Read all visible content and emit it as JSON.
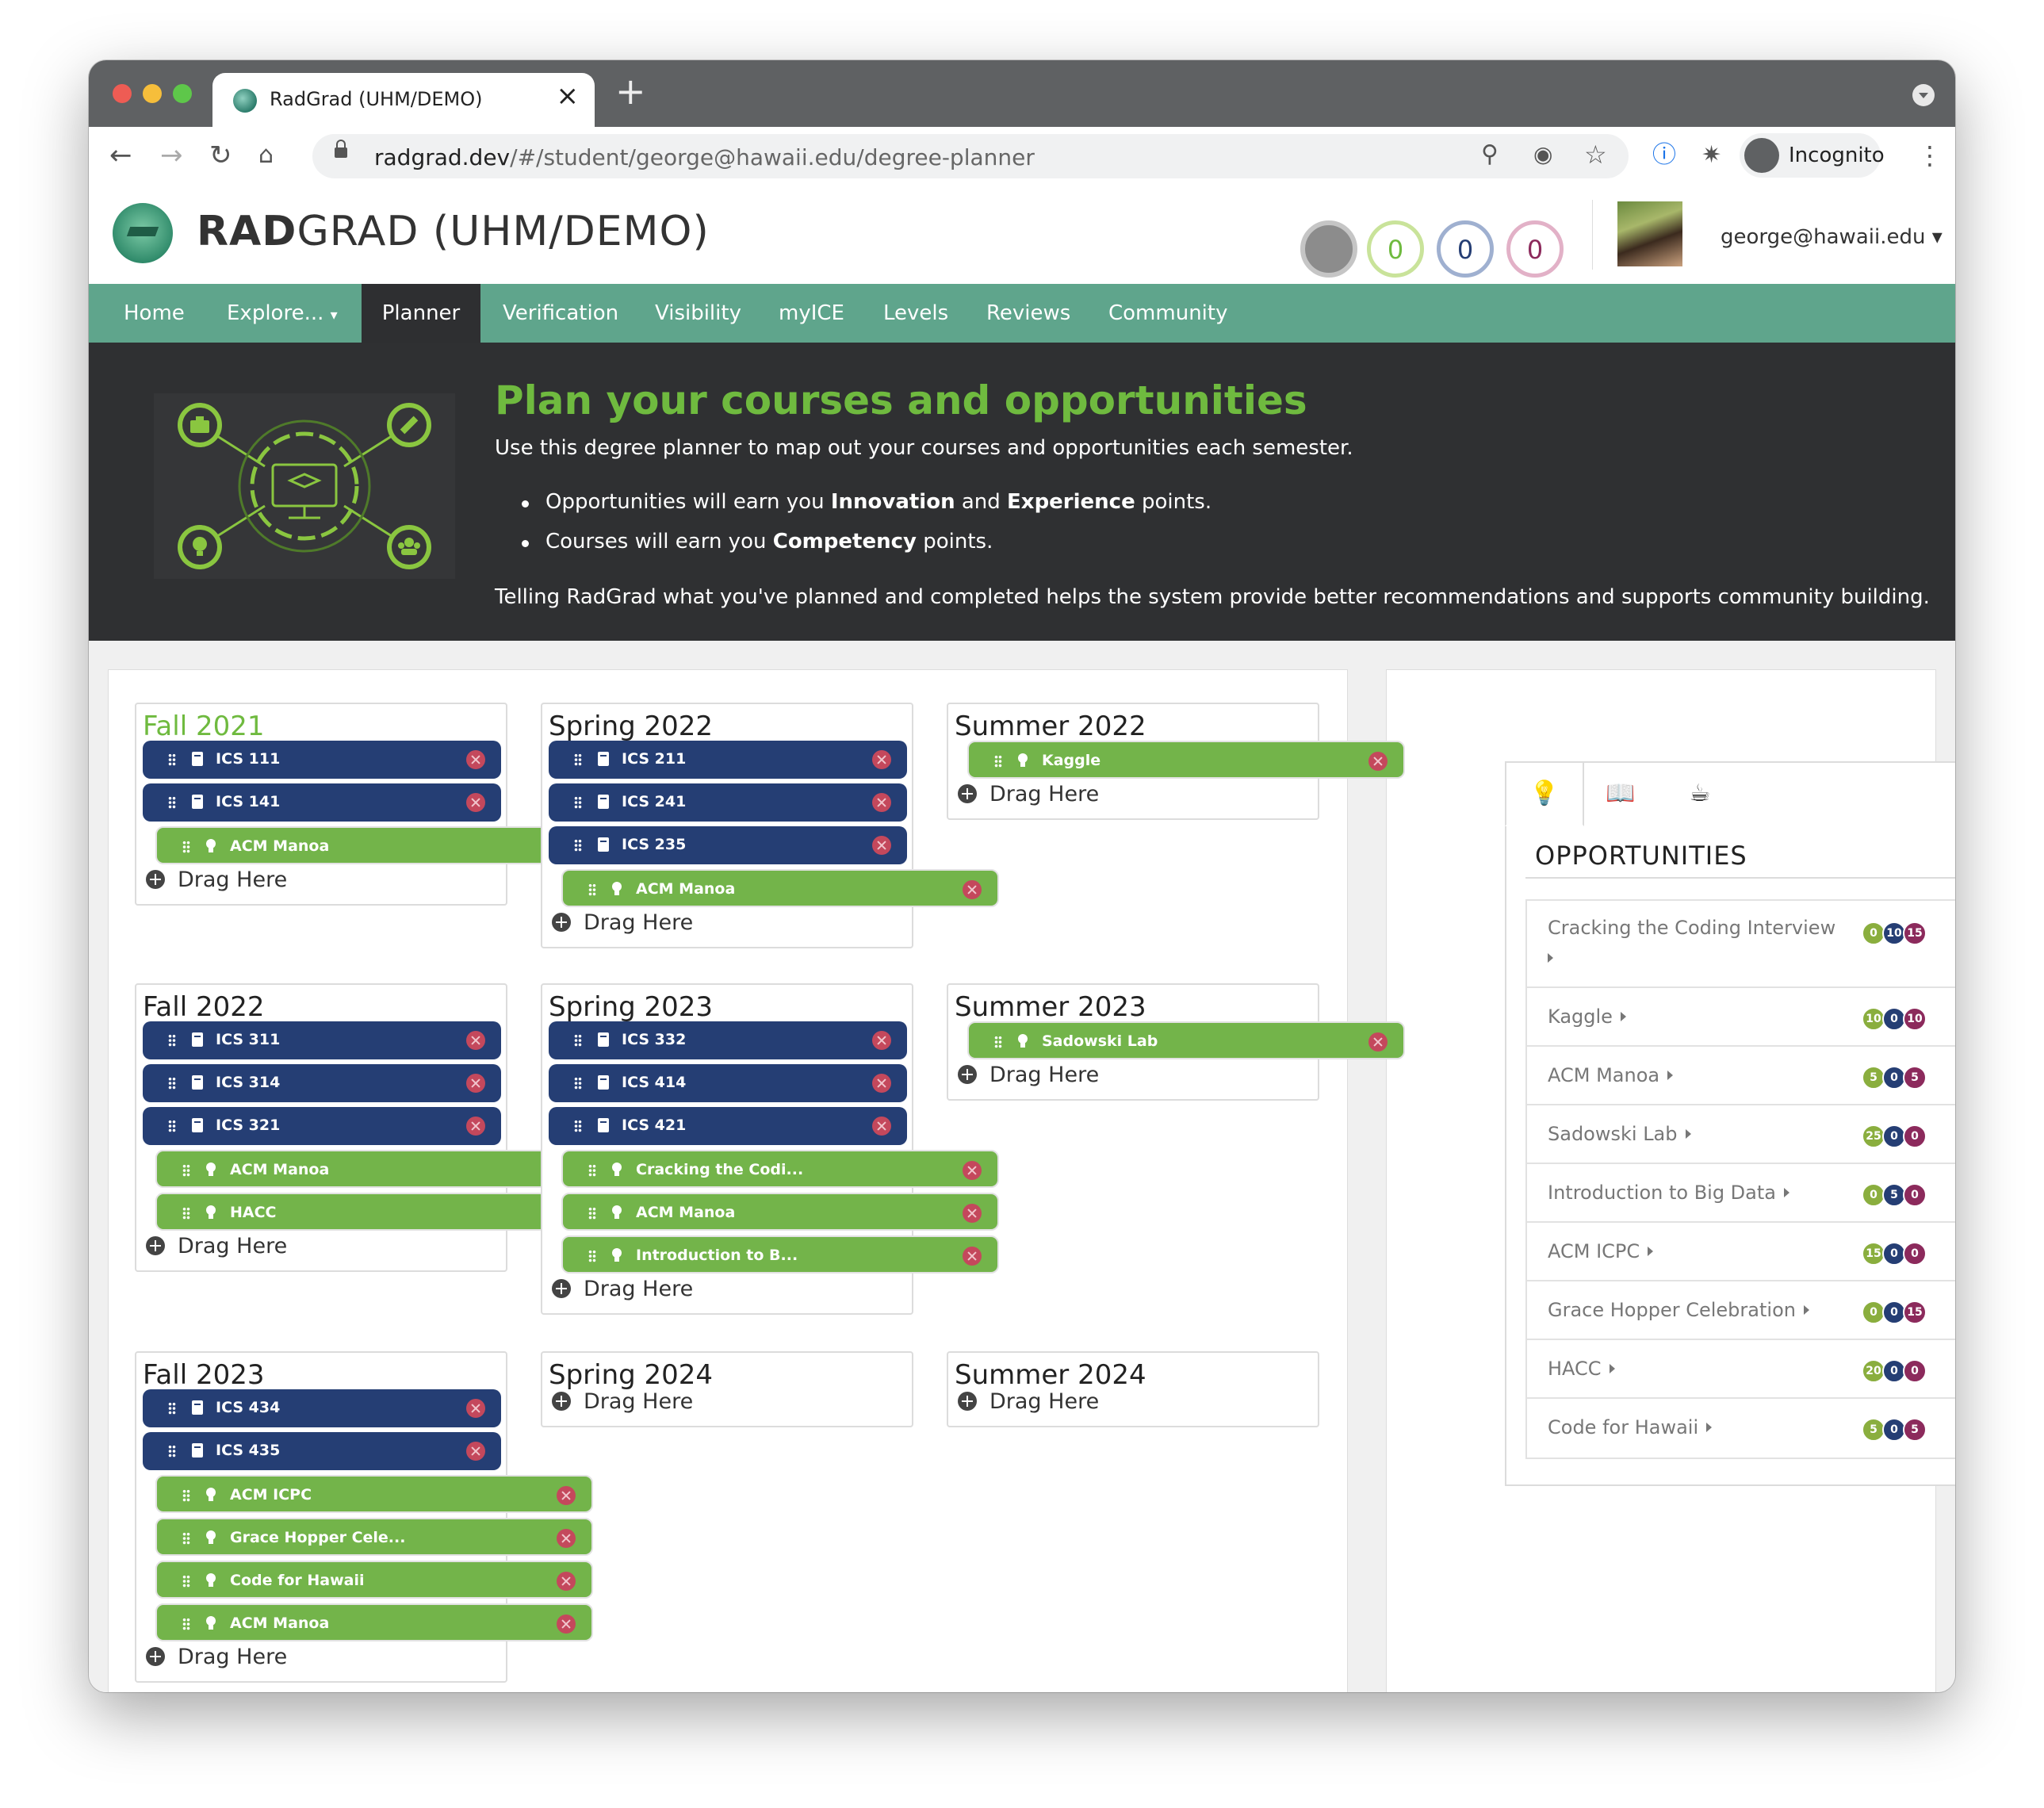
{
  "browser": {
    "tab_title": "RadGrad (UHM/DEMO)",
    "url_host": "radgrad.dev",
    "url_path": "/#/student/george@hawaii.edu/degree-planner",
    "incognito_label": "Incognito"
  },
  "header": {
    "brand_bold": "RAD",
    "brand_rest": "GRAD (UHM/DEMO)",
    "ice_innovation": "0",
    "ice_competency": "0",
    "ice_experience": "0",
    "user_label": "george@hawaii.edu"
  },
  "nav": {
    "items": [
      "Home",
      "Explore...",
      "Planner",
      "Verification",
      "Visibility",
      "myICE",
      "Levels",
      "Reviews",
      "Community"
    ],
    "active": "Planner"
  },
  "banner": {
    "title": "Plan your courses and opportunities",
    "intro": "Use this degree planner to map out your courses and opportunities each semester.",
    "bullet1_a": "Opportunities will earn you ",
    "bullet1_b": "Innovation",
    "bullet1_c": " and ",
    "bullet1_d": "Experience",
    "bullet1_e": " points.",
    "bullet2_a": "Courses will earn you ",
    "bullet2_b": "Competency",
    "bullet2_c": " points.",
    "footer": "Telling RadGrad what you've planned and completed helps the system provide better recommendations and supports community building."
  },
  "planner": {
    "drag_label": "Drag Here",
    "semesters": [
      {
        "name": "Fall 2021",
        "current": true,
        "items": [
          {
            "type": "course",
            "label": "ICS 111"
          },
          {
            "type": "course",
            "label": "ICS 141"
          },
          {
            "type": "opp",
            "label": "ACM Manoa"
          }
        ]
      },
      {
        "name": "Spring 2022",
        "items": [
          {
            "type": "course",
            "label": "ICS 211"
          },
          {
            "type": "course",
            "label": "ICS 241"
          },
          {
            "type": "course",
            "label": "ICS 235"
          },
          {
            "type": "opp",
            "label": "ACM Manoa"
          }
        ]
      },
      {
        "name": "Summer 2022",
        "items": [
          {
            "type": "opp",
            "label": "Kaggle"
          }
        ]
      },
      {
        "name": "Fall 2022",
        "items": [
          {
            "type": "course",
            "label": "ICS 311"
          },
          {
            "type": "course",
            "label": "ICS 314"
          },
          {
            "type": "course",
            "label": "ICS 321"
          },
          {
            "type": "opp",
            "label": "ACM Manoa"
          },
          {
            "type": "opp",
            "label": "HACC"
          }
        ]
      },
      {
        "name": "Spring 2023",
        "items": [
          {
            "type": "course",
            "label": "ICS 332"
          },
          {
            "type": "course",
            "label": "ICS 414"
          },
          {
            "type": "course",
            "label": "ICS 421"
          },
          {
            "type": "opp",
            "label": "Cracking the Codi..."
          },
          {
            "type": "opp",
            "label": "ACM Manoa"
          },
          {
            "type": "opp",
            "label": "Introduction to B..."
          }
        ]
      },
      {
        "name": "Summer 2023",
        "items": [
          {
            "type": "opp",
            "label": "Sadowski Lab"
          }
        ]
      },
      {
        "name": "Fall 2023",
        "items": [
          {
            "type": "course",
            "label": "ICS 434"
          },
          {
            "type": "course",
            "label": "ICS 435"
          },
          {
            "type": "opp",
            "label": "ACM ICPC"
          },
          {
            "type": "opp",
            "label": "Grace Hopper Cele..."
          },
          {
            "type": "opp",
            "label": "Code for Hawaii"
          },
          {
            "type": "opp",
            "label": "ACM Manoa"
          }
        ]
      },
      {
        "name": "Spring 2024",
        "items": []
      },
      {
        "name": "Summer 2024",
        "items": []
      }
    ]
  },
  "sidebar": {
    "tabs": [
      "opportunities-tab",
      "courses-tab",
      "profile-tab"
    ],
    "title": "OPPORTUNITIES",
    "opportunities": [
      {
        "name": "Cracking the Coding Interview",
        "i": "0",
        "c": "10",
        "e": "15"
      },
      {
        "name": "Kaggle",
        "i": "10",
        "c": "0",
        "e": "10"
      },
      {
        "name": "ACM Manoa",
        "i": "5",
        "c": "0",
        "e": "5"
      },
      {
        "name": "Sadowski Lab",
        "i": "25",
        "c": "0",
        "e": "0"
      },
      {
        "name": "Introduction to Big Data",
        "i": "0",
        "c": "5",
        "e": "0"
      },
      {
        "name": "ACM ICPC",
        "i": "15",
        "c": "0",
        "e": "0"
      },
      {
        "name": "Grace Hopper Celebration",
        "i": "0",
        "c": "0",
        "e": "15"
      },
      {
        "name": "HACC",
        "i": "20",
        "c": "0",
        "e": "0"
      },
      {
        "name": "Code for Hawaii",
        "i": "5",
        "c": "0",
        "e": "5"
      }
    ]
  },
  "colors": {
    "nav_green": "#5fa58c",
    "title_green": "#6fba3f",
    "course_blue": "#253e74",
    "opp_green": "#73b44a",
    "innovation": "#8aae3e",
    "competency": "#253e74",
    "experience": "#8c2a5c"
  }
}
